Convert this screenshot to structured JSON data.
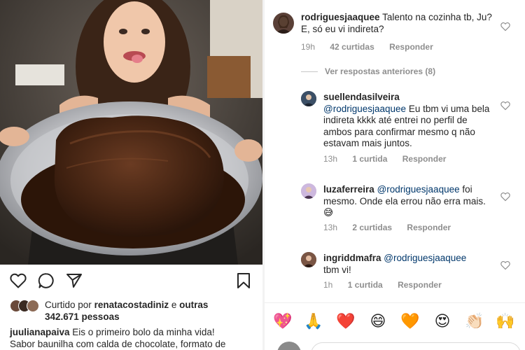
{
  "post": {
    "photo_alt": "",
    "actions": {
      "like_icon": "heart-outline-icon",
      "comment_icon": "comment-bubble-icon",
      "share_icon": "paper-plane-icon",
      "save_icon": "bookmark-icon"
    },
    "likes": {
      "prefix": "Curtido por",
      "user": "renatacostadiniz",
      "connector": "e",
      "others_label": "outras",
      "count": "342.671 pessoas"
    },
    "caption": {
      "user": "juulianapaiva",
      "line1": "Eis o primeiro bolo da minha vida!",
      "line2": "Sabor baunilha com calda de chocolate, formato de"
    }
  },
  "comments": [
    {
      "user": "rodriguesjaaquee",
      "text": "Talento na cozinha tb, Ju? E, só eu vi indireta?",
      "time": "19h",
      "likes": "42 curtidas",
      "reply": "Responder"
    },
    {
      "view_previous": "Ver respostas anteriores (8)"
    },
    {
      "user": "suellendasilveira",
      "mention": "@rodriguesjaaquee",
      "text": "Eu tbm vi uma bela indireta kkkk até entrei no perfil de ambos para confirmar mesmo q não estavam mais juntos.",
      "time": "13h",
      "likes": "1 curtida",
      "reply": "Responder"
    },
    {
      "user": "luzaferreira",
      "mention": "@rodriguesjaaquee",
      "text": "foi mesmo. Onde ela errou não erra mais.",
      "emoji": "😅",
      "time": "13h",
      "likes": "2 curtidas",
      "reply": "Responder"
    },
    {
      "user": "ingriddmafra",
      "mention": "@rodriguesjaaquee",
      "text": "tbm vi!",
      "time": "1h",
      "likes": "1 curtida",
      "reply": "Responder"
    }
  ],
  "emoji_bar": [
    "💖",
    "🙏",
    "❤️",
    "😄",
    "🧡",
    "😍",
    "👏🏻",
    "🙌"
  ],
  "colors": {
    "text": "#262626",
    "muted": "#8e8e8e",
    "mention": "#00376b",
    "divider": "#efefef"
  }
}
